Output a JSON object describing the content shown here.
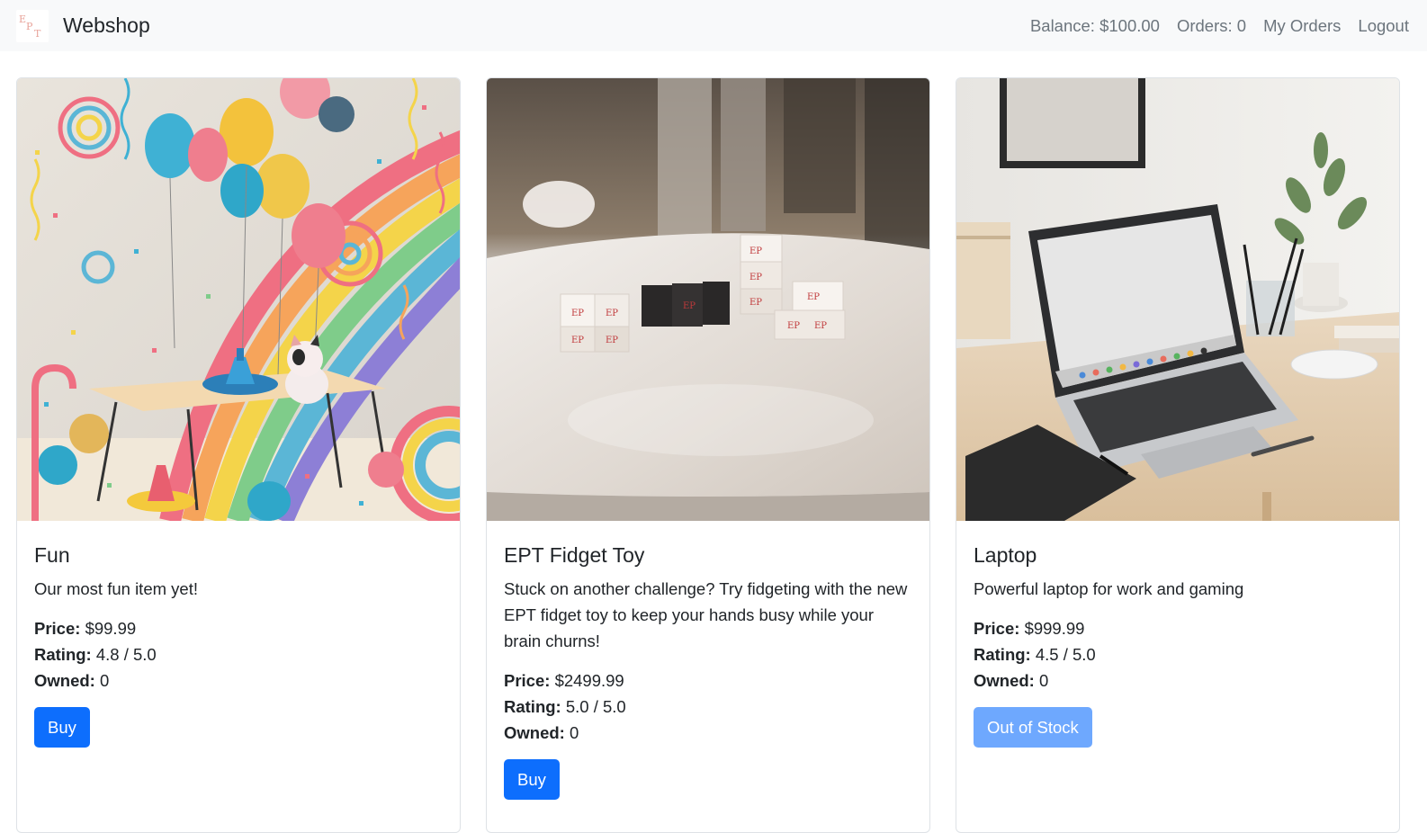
{
  "navbar": {
    "brand": "Webshop",
    "logo_icon": "ept-logo-icon",
    "balance": "Balance: $100.00",
    "orders": "Orders: 0",
    "my_orders": "My Orders",
    "logout": "Logout"
  },
  "labels": {
    "price": "Price:",
    "rating": "Rating:",
    "owned": "Owned:"
  },
  "products": [
    {
      "title": "Fun",
      "description": "Our most fun item yet!",
      "price": "$99.99",
      "rating": "4.8 / 5.0",
      "owned": "0",
      "button": "Buy",
      "button_enabled": true
    },
    {
      "title": "EPT Fidget Toy",
      "description": "Stuck on another challenge? Try fidgeting with the new EPT fidget toy to keep your hands busy while your brain churns!",
      "price": "$2499.99",
      "rating": "5.0 / 5.0",
      "owned": "0",
      "button": "Buy",
      "button_enabled": true
    },
    {
      "title": "Laptop",
      "description": "Powerful laptop for work and gaming",
      "price": "$999.99",
      "rating": "4.5 / 5.0",
      "owned": "0",
      "button": "Out of Stock",
      "button_enabled": false
    }
  ],
  "colors": {
    "primary": "#0d6efd",
    "primary_disabled": "#6ea8fe",
    "navbar_bg": "#f8f9fa",
    "nav_text": "#6c757d"
  }
}
